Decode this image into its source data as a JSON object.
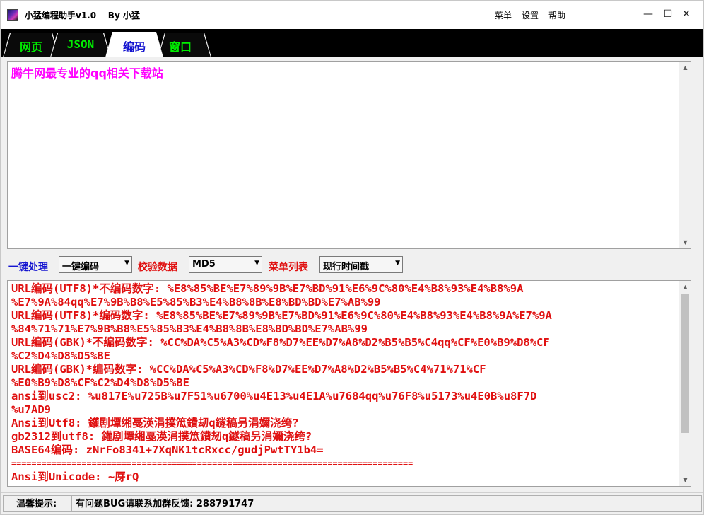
{
  "window": {
    "title": "小猛编程助手v1.0    By 小猛",
    "menu": [
      "菜单",
      "设置",
      "帮助"
    ],
    "controls": {
      "minimize": "—",
      "maximize": "☐",
      "close": "✕"
    }
  },
  "tabs": [
    {
      "label": "网页",
      "active": false
    },
    {
      "label": "JSON",
      "active": false
    },
    {
      "label": "编码",
      "active": true
    },
    {
      "label": "窗口",
      "active": false
    }
  ],
  "input": {
    "text": "腾牛网最专业的qq相关下载站"
  },
  "toolbar": {
    "label1": "一键处理",
    "select1": "一键编码",
    "label2": "校验数据",
    "select2": "MD5",
    "label3": "菜单列表",
    "select3": "现行时间戳"
  },
  "output": {
    "lines": [
      "URL编码(UTF8)*不编码数字: %E8%85%BE%E7%89%9B%E7%BD%91%E6%9C%80%E4%B8%93%E4%B8%9A",
      "%E7%9A%84qq%E7%9B%B8%E5%85%B3%E4%B8%8B%E8%BD%BD%E7%AB%99",
      "URL编码(UTF8)*编码数字: %E8%85%BE%E7%89%9B%E7%BD%91%E6%9C%80%E4%B8%93%E4%B8%9A%E7%9A",
      "%84%71%71%E7%9B%B8%E5%85%B3%E4%B8%8B%E8%BD%BD%E7%AB%99",
      "URL编码(GBK)*不编码数字: %CC%DA%C5%A3%CD%F8%D7%EE%D7%A8%D2%B5%B5%C4qq%CF%E0%B9%D8%CF",
      "%C2%D4%D8%D5%BE",
      "URL编码(GBK)*编码数字: %CC%DA%C5%A3%CD%F8%D7%EE%D7%A8%D2%B5%B5%C4%71%71%CF",
      "%E0%B9%D8%CF%C2%D4%D8%D5%BE",
      "ansi到usc2: %u817E%u725B%u7F51%u6700%u4E13%u4E1A%u7684qq%u76F8%u5173%u4E0B%u8F7D",
      "%u7AD9",
      "Ansi到Utf8: 鑵剧墰缃戞渶涓撲笟鐨刼q鐩稿叧涓嬭浇绔?",
      "gb2312到utf8: 鑵剧墰缃戞渶涓撲笟鐨刼q鐩稿叧涓嬭浇绔?",
      "BASE64编码: zNrFo8341+7XqNK1tcRxcc/gudjPwtTY1b4=",
      "================================================================================",
      "Ansi到Unicode: ~厊rQ"
    ]
  },
  "status": {
    "label": "温馨提示:",
    "message": "有问题BUG请联系加群反馈: 288791747"
  }
}
